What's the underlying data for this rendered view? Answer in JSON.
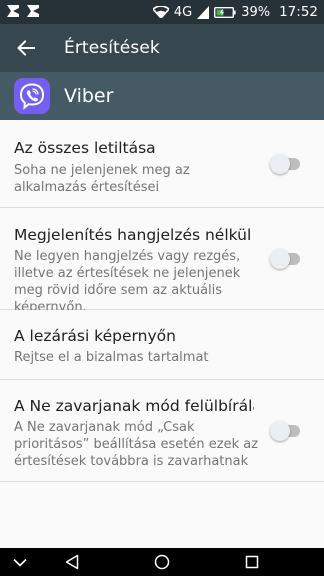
{
  "status_bar": {
    "network": "4G",
    "battery": "39%",
    "time": "17:52",
    "icons": [
      "app-notification-icon",
      "app-notification-icon",
      "wifi-icon",
      "signal-icon",
      "battery-icon"
    ]
  },
  "toolbar": {
    "title": "Értesítések",
    "back_icon": "arrow-back-icon"
  },
  "app": {
    "name": "Viber",
    "icon": "viber-logo",
    "brand_color": "#7360f2"
  },
  "settings": [
    {
      "title": "Az összes letiltása",
      "subtitle": "Soha ne jelenjenek meg az alkalmazás értesítései",
      "has_toggle": true,
      "enabled": false
    },
    {
      "title": "Megjelenítés hangjelzés nélkül",
      "subtitle": "Ne legyen hangjelzés vagy rezgés, illetve az értesítések ne jelenjenek meg rövid időre sem az aktuális képernyőn.",
      "has_toggle": true,
      "enabled": false
    },
    {
      "title": "A lezárási képernyőn",
      "subtitle": "Rejtse el a bizalmas tartalmat",
      "has_toggle": false
    },
    {
      "title": "A Ne zavarjanak mód felülbírálá..",
      "subtitle": "A Ne zavarjanak mód „Csak prioritásos” beállítása esetén ezek az értesítések továbbra is zavarhatnak",
      "has_toggle": true,
      "enabled": false
    }
  ],
  "nav_bar": {
    "buttons": [
      "chevron-down-icon",
      "back-triangle-icon",
      "home-circle-icon",
      "recents-square-icon"
    ]
  },
  "colors": {
    "status_bar": "#263238",
    "toolbar": "#37474f",
    "app_header": "#455a64",
    "background": "#fafafa"
  }
}
